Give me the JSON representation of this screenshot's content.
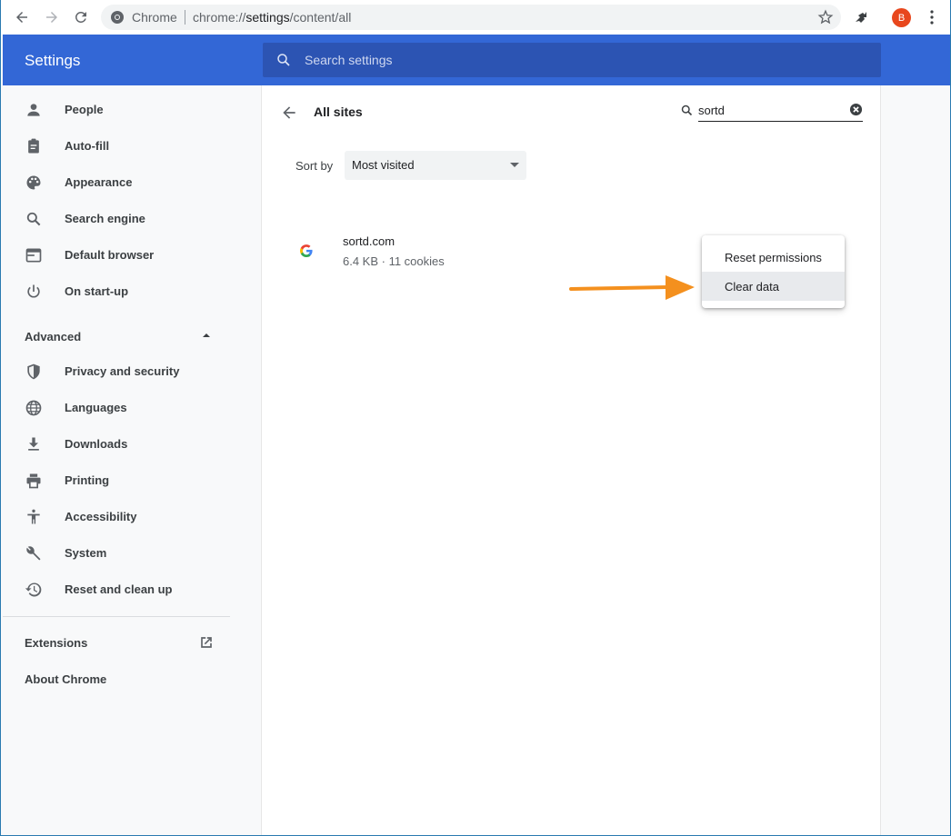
{
  "browser": {
    "site_label": "Chrome",
    "url_scheme": "chrome://",
    "url_host": "settings",
    "url_path": "/content/all",
    "avatar_letter": "B"
  },
  "header": {
    "title": "Settings",
    "search_placeholder": "Search settings"
  },
  "sidebar": {
    "items": [
      {
        "label": "People",
        "icon": "person-icon"
      },
      {
        "label": "Auto-fill",
        "icon": "clipboard-icon"
      },
      {
        "label": "Appearance",
        "icon": "palette-icon"
      },
      {
        "label": "Search engine",
        "icon": "search-icon"
      },
      {
        "label": "Default browser",
        "icon": "browser-icon"
      },
      {
        "label": "On start-up",
        "icon": "power-icon"
      }
    ],
    "advanced_label": "Advanced",
    "advanced_items": [
      {
        "label": "Privacy and security",
        "icon": "shield-icon"
      },
      {
        "label": "Languages",
        "icon": "globe-icon"
      },
      {
        "label": "Downloads",
        "icon": "download-icon"
      },
      {
        "label": "Printing",
        "icon": "printer-icon"
      },
      {
        "label": "Accessibility",
        "icon": "accessibility-icon"
      },
      {
        "label": "System",
        "icon": "wrench-icon"
      },
      {
        "label": "Reset and clean up",
        "icon": "history-icon"
      }
    ],
    "extensions_label": "Extensions",
    "about_label": "About Chrome"
  },
  "main": {
    "title": "All sites",
    "site_search_value": "sortd",
    "sort_label": "Sort by",
    "sort_value": "Most visited",
    "sites": [
      {
        "name": "sortd.com",
        "meta": "6.4 KB · 11 cookies"
      }
    ],
    "menu": {
      "items": [
        "Reset permissions",
        "Clear data"
      ]
    }
  },
  "colors": {
    "header_blue": "#3367d6",
    "search_blue": "#2c54b3",
    "annotation_arrow": "#f4901e",
    "avatar": "#e8471d"
  }
}
